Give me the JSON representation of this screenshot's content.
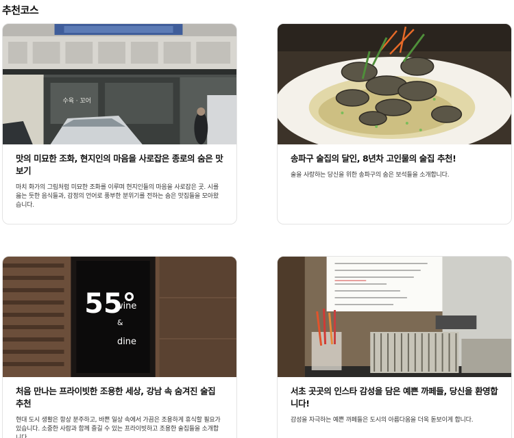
{
  "section": {
    "title": "추천코스"
  },
  "cards": [
    {
      "title": "맛의 미묘한 조화, 현지인의 마음을 사로잡은 종로의 숨은 맛보기",
      "desc": "마치 화가의 그림처럼 미묘한 조화를 이루며 현지인들의 마음을 사로잡은 곳. 시를 읊는 듯한 음식들과, 감정의 언어로 풍부한 분위기를 전하는 숨은 맛집들을 모아왔습니다.",
      "image_icon": "restaurant-storefront-photo",
      "sign_text": "수육 · 꼬어"
    },
    {
      "title": "송파구 술집의 달인, 8년차 고인물의 술집 추천!",
      "desc": "술을 사랑하는 당신을 위한 송파구의 숨은 보석들을 소개합니다.",
      "image_icon": "clam-soup-dish-photo"
    },
    {
      "title": "처음 만나는 프라이빗한 조용한 세상, 강남 속 숨겨진 술집 추천",
      "desc": "현대 도시 생활은 항상 분주하고, 바쁜 일상 속에서 가끔은 조용하게 휴식할 필요가 있습니다. 소중한 사람과 함께 즐길 수 있는 프라이빗하고 조용한 술집들을 소개합니다.",
      "image_icon": "wine-bar-sign-photo",
      "sign_text": [
        "55°",
        "wine",
        "&",
        "dine"
      ]
    },
    {
      "title": "서초 곳곳의 인스타 감성을 담은 예쁜 까페들, 당신을 환영합니다!",
      "desc": "감성을 자극하는 예쁜 까페들은 도시의 아름다움을 더욱 돋보이게 합니다.",
      "image_icon": "cafe-counter-photo"
    }
  ]
}
